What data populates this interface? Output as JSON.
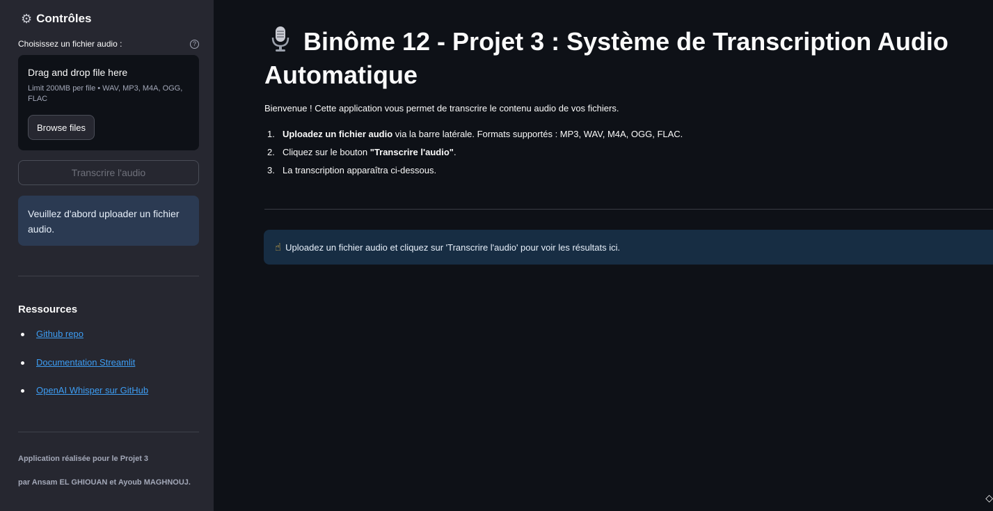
{
  "sidebar": {
    "header": "Contrôles",
    "header_icon": "gear-icon",
    "uploader": {
      "label": "Choisissez un fichier audio :",
      "help_icon": "?",
      "drop_text": "Drag and drop file here",
      "limit_text": "Limit 200MB per file • WAV, MP3, M4A, OGG, FLAC",
      "browse_label": "Browse files"
    },
    "transcribe_label": "Transcrire l'audio",
    "info_text": "Veuillez d'abord uploader un fichier audio.",
    "resources_title": "Ressources",
    "resources": [
      {
        "label": "Github repo"
      },
      {
        "label": "Documentation Streamlit"
      },
      {
        "label": "OpenAI Whisper sur GitHub"
      }
    ],
    "footer_line1": "Application réalisée pour le Projet 3",
    "footer_line2": "par Ansam EL GHIOUAN et Ayoub MAGHNOUJ."
  },
  "main": {
    "title_icon": "microphone-icon",
    "title": "Binôme 12 - Projet 3 : Système de Transcription Audio Automatique",
    "intro": "Bienvenue ! Cette application vous permet de transcrire le contenu audio de vos fichiers.",
    "steps": [
      {
        "num": "1.",
        "bold": "Uploadez un fichier audio",
        "rest": " via la barre latérale. Formats supportés : MP3, WAV, M4A, OGG, FLAC."
      },
      {
        "num": "2.",
        "pre": "Cliquez sur le bouton ",
        "bold": "\"Transcrire l'audio\"",
        "rest": "."
      },
      {
        "num": "3.",
        "pre": "La transcription apparaîtra ci-dessous."
      }
    ],
    "info_icon": "pointing-up-hand-icon",
    "info_text": "Uploadez un fichier audio et cliquez sur 'Transcrire l'audio' pour voir les résultats ici."
  },
  "colors": {
    "background": "#0e1117",
    "sidebar": "#262730",
    "link": "#3d9df3",
    "sidebar_info_bg": "#2b3a52",
    "main_info_bg": "#172d43"
  }
}
